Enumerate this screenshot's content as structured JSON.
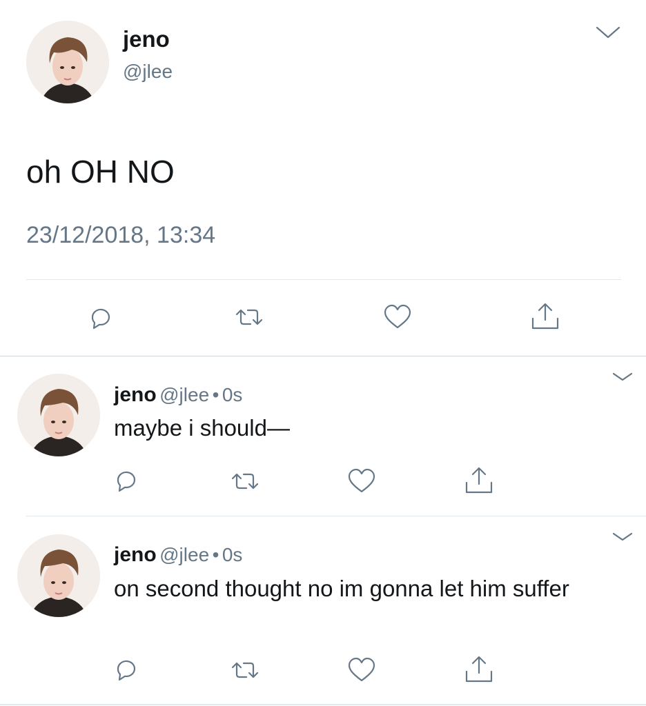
{
  "main_tweet": {
    "name": "jeno",
    "handle": "@jlee",
    "text": "oh OH NO",
    "timestamp": "23/12/2018, 13:34"
  },
  "replies": [
    {
      "name": "jeno",
      "handle": "@jlee",
      "separator": "•",
      "time": "0s",
      "text": "maybe i should—"
    },
    {
      "name": "jeno",
      "handle": "@jlee",
      "separator": "•",
      "time": "0s",
      "text": "on second thought no im gonna let him suffer"
    }
  ],
  "icons": {
    "reply": "reply-icon",
    "retweet": "retweet-icon",
    "like": "heart-icon",
    "share": "share-icon",
    "menu": "chevron-down-icon"
  },
  "colors": {
    "text": "#14171a",
    "secondary": "#657786",
    "divider": "#e1e8ed"
  }
}
